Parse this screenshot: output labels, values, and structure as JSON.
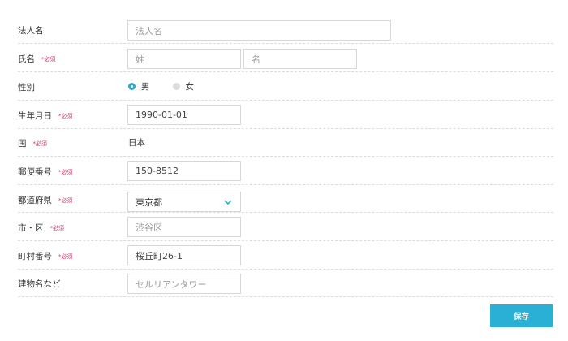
{
  "form": {
    "required_mark": "*必須",
    "corporate_name": {
      "label": "法人名",
      "placeholder": "法人名"
    },
    "name": {
      "label": "氏名",
      "last_placeholder": "姓",
      "first_placeholder": "名"
    },
    "gender": {
      "label": "性別",
      "options": [
        {
          "label": "男",
          "selected": true
        },
        {
          "label": "女",
          "selected": false
        }
      ]
    },
    "birthdate": {
      "label": "生年月日",
      "value": "1990-01-01"
    },
    "country": {
      "label": "国",
      "value": "日本"
    },
    "postal_code": {
      "label": "郵便番号",
      "placeholder": "150-8512"
    },
    "prefecture": {
      "label": "都道府県",
      "value": "東京都"
    },
    "city": {
      "label": "市・区",
      "placeholder": "渋谷区"
    },
    "town": {
      "label": "町村番号",
      "placeholder": "桜丘町26-1"
    },
    "building": {
      "label": "建物名など",
      "placeholder": "セルリアンタワー"
    },
    "save_label": "保存"
  },
  "colors": {
    "accent": "#2ab0d5",
    "required": "#d3386a",
    "radio_selected": "#3aa7c9"
  },
  "icons": {
    "select_arrow": "chevron-down-icon"
  }
}
